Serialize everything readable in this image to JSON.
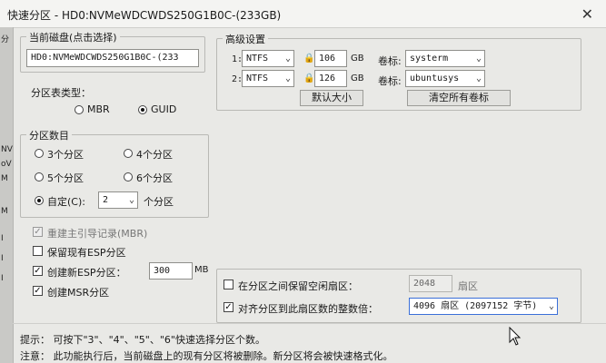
{
  "window": {
    "title": "快速分区 - HD0:NVMeWDCWDS250G1B0C-(233GB)",
    "close": "✕"
  },
  "left_strip": {
    "labels": [
      "分",
      "NV",
      "oV",
      "M",
      "M",
      "I",
      "I",
      "I"
    ]
  },
  "current_disk": {
    "label": "当前磁盘(点击选择)",
    "value": "HD0:NVMeWDCWDS250G1B0C-(233"
  },
  "partition_table": {
    "label": "分区表类型：",
    "mbr": "MBR",
    "guid": "GUID",
    "selected": "GUID"
  },
  "partition_count": {
    "label": "分区数目",
    "options": [
      "3个分区",
      "4个分区",
      "5个分区",
      "6个分区"
    ],
    "custom_label": "自定(C):",
    "custom_value": "2",
    "custom_suffix": "个分区",
    "selected": "custom"
  },
  "checks": {
    "rebuild_mbr": {
      "label": "重建主引导记录(MBR)",
      "checked": true,
      "disabled": true
    },
    "keep_esp": {
      "label": "保留现有ESP分区",
      "checked": false
    },
    "new_esp": {
      "label": "创建新ESP分区：",
      "checked": true,
      "value": "300",
      "unit": "MB"
    },
    "create_msr": {
      "label": "创建MSR分区",
      "checked": true
    }
  },
  "advanced": {
    "label": "高级设置",
    "rows": [
      {
        "index": "1:",
        "fs": "NTFS",
        "size": "106",
        "unit": "GB",
        "vol_label": "卷标:",
        "vol": "systerm"
      },
      {
        "index": "2:",
        "fs": "NTFS",
        "size": "126",
        "unit": "GB",
        "vol_label": "卷标:",
        "vol": "ubuntusys"
      }
    ],
    "default_size_btn": "默认大小",
    "clear_labels_btn": "清空所有卷标"
  },
  "gap": {
    "label": "在分区之间保留空闲扇区：",
    "checked": false,
    "value": "2048",
    "unit": "扇区"
  },
  "align": {
    "label": "对齐分区到此扇区数的整数倍：",
    "checked": true,
    "value": "4096 扇区 (2097152 字节)"
  },
  "footer": {
    "tip": "提示： 可按下\"3\"、\"4\"、\"5\"、\"6\"快速选择分区个数。",
    "note": "注意： 此功能执行后，当前磁盘上的现有分区将被删除。新分区将会被快速格式化。"
  },
  "colors": {
    "window_bg": "#e9e9e6",
    "title_bg": "#f4f4f2"
  }
}
